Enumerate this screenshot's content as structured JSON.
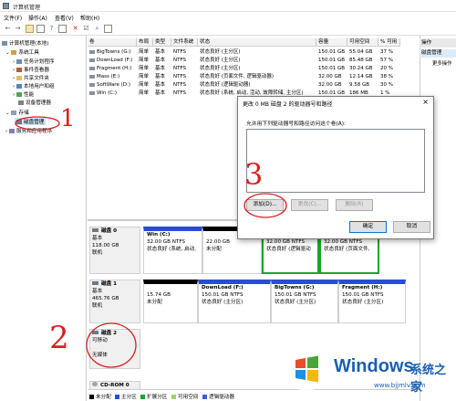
{
  "window": {
    "title": "计算机管理"
  },
  "menu": [
    "文件(F)",
    "操作(A)",
    "查看(V)",
    "帮助(H)"
  ],
  "tree": {
    "root": "计算机管理(本地)",
    "system_tools": "系统工具",
    "task_scheduler": "任务计划程序",
    "event_viewer": "事件查看器",
    "shared_folders": "共享文件夹",
    "local_users": "本地用户和组",
    "performance": "性能",
    "device_manager": "设备管理器",
    "storage": "存储",
    "disk_management": "磁盘管理",
    "services": "服务和应用程序"
  },
  "list": {
    "headers": [
      "卷",
      "布局",
      "类型",
      "文件系统",
      "状态",
      "容量",
      "可用空间",
      "% 可用"
    ],
    "rows": [
      [
        "BigTowns (G:)",
        "简单",
        "基本",
        "NTFS",
        "状态良好 (主分区)",
        "150.01 GB",
        "55.04 GB",
        "37 %"
      ],
      [
        "DownLoad (F:)",
        "简单",
        "基本",
        "NTFS",
        "状态良好 (主分区)",
        "150.01 GB",
        "85.48 GB",
        "57 %"
      ],
      [
        "Fragment (H:)",
        "简单",
        "基本",
        "NTFS",
        "状态良好 (主分区)",
        "150.01 GB",
        "30.24 GB",
        "20 %"
      ],
      [
        "Mass (E:)",
        "简单",
        "基本",
        "NTFS",
        "状态良好 (页面文件, 逻辑驱动器)",
        "32.00 GB",
        "12.14 GB",
        "38 %"
      ],
      [
        "SoftWare (D:)",
        "简单",
        "基本",
        "NTFS",
        "状态良好 (逻辑驱动器)",
        "32.00 GB",
        "9.58 GB",
        "30 %"
      ],
      [
        "Win (C:)",
        "简单",
        "基本",
        "NTFS",
        "状态良好 (系统, 启动, 活动, 故障转储, 主分区)",
        "150.01 GB",
        "186 MB",
        "1 %"
      ]
    ]
  },
  "actions": {
    "header": "操作",
    "selected": "磁盘管理",
    "more": "更多操作"
  },
  "disks": {
    "disk0": {
      "name": "磁盘 0",
      "type": "基本",
      "size": "118.00 GB",
      "status": "联机"
    },
    "disk1": {
      "name": "磁盘 1",
      "type": "基本",
      "size": "465.76 GB",
      "status": "联机"
    },
    "disk2": {
      "name": "磁盘 2",
      "type": "可移动",
      "media": "无媒体"
    },
    "cdrom": {
      "name": "CD-ROM 0"
    },
    "parts0": [
      {
        "name": "Win (C:)",
        "size": "32.00 GB NTFS",
        "status": "状态良好 (系统, 启动,"
      },
      {
        "name": "",
        "size": "22.00 GB",
        "status": "未分配"
      },
      {
        "name": "",
        "size": "32.00 GB NTFS",
        "status": "状态良好 (逻辑驱动"
      },
      {
        "name": "",
        "size": "32.00 GB NTFS",
        "status": "状态良好 (页面文件,"
      }
    ],
    "parts1": [
      {
        "name": "",
        "size": "15.74 GB",
        "status": "未分配"
      },
      {
        "name": "DownLoad (F:)",
        "size": "150.01 GB NTFS",
        "status": "状态良好 (主分区)"
      },
      {
        "name": "BigTowns (G:)",
        "size": "150.01 GB NTFS",
        "status": "状态良好 (主分区)"
      },
      {
        "name": "Fragment (H:)",
        "size": "150.01 GB NTFS",
        "status": "状态良好 (主分区)"
      }
    ]
  },
  "legend": [
    "未分配",
    "主分区",
    "扩展分区",
    "可用空间",
    "逻辑驱动器"
  ],
  "legend_colors": [
    "#000000",
    "#2a4bd7",
    "#1fa32b",
    "#9ed36b",
    "#3a5dd9"
  ],
  "dialog": {
    "title": "更改 0 MB   磁盘 2 的驱动器号和路径",
    "close": "×",
    "desc": "允许用下列驱动器号和路径访问这个卷(A):",
    "add": "添加(D)...",
    "change": "更改(C)...",
    "remove": "删除(R)",
    "ok": "确定",
    "cancel": "取消"
  },
  "annotations": {
    "one": "1",
    "two": "2",
    "three": "3"
  },
  "watermark": {
    "brand": "Windows",
    "suffix": "系统之家",
    "url": "www.bjjmlv.com"
  }
}
